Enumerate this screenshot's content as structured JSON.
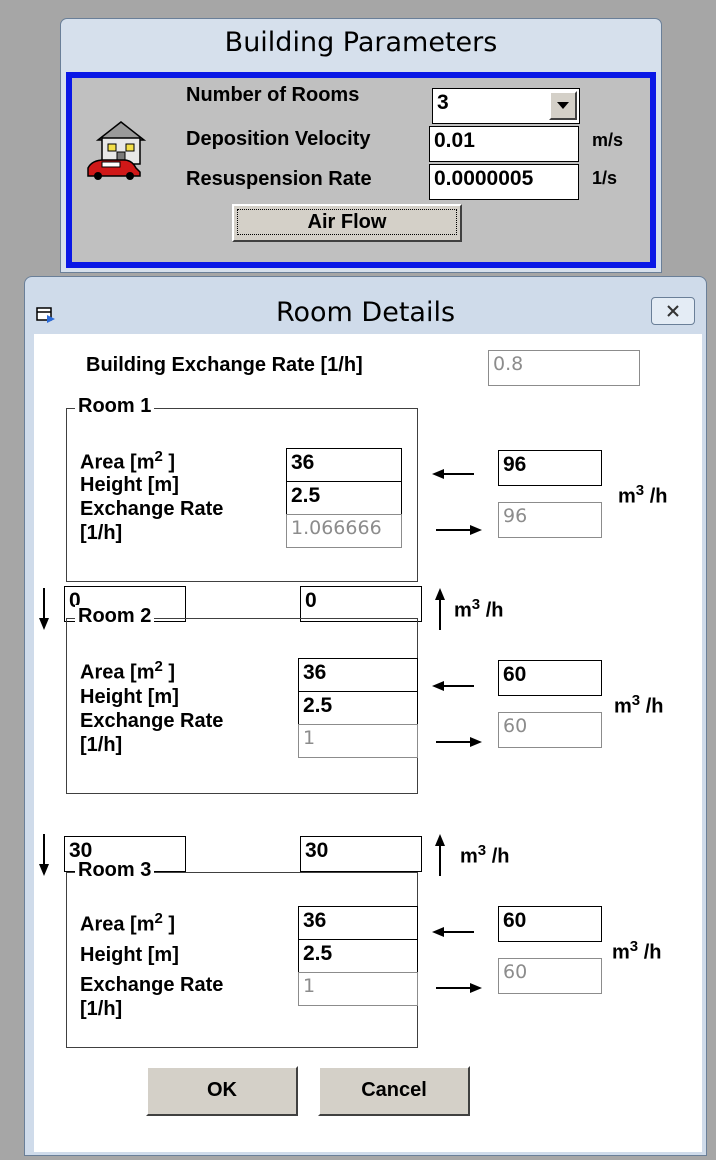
{
  "building_parameters": {
    "title": "Building Parameters",
    "rooms_label": "Number of Rooms",
    "rooms_value": "3",
    "deposition_label": "Deposition Velocity",
    "deposition_value": "0.01",
    "deposition_unit": "m/s",
    "resuspension_label": "Resuspension Rate",
    "resuspension_value": "0.0000005",
    "resuspension_unit": "1/s",
    "airflow_button": "Air Flow"
  },
  "room_details": {
    "title": "Room Details",
    "exchange_rate_label": "Building Exchange Rate [1/h]",
    "exchange_rate_value": "0.8",
    "area_label_pre": "Area [m",
    "area_sup": "2",
    "area_label_post": " ]",
    "height_label": "Height [m]",
    "exch_label_1": "Exchange Rate",
    "exch_label_2": "[1/h]",
    "unit_m": "m",
    "unit_sup": "3",
    "unit_h": " /h",
    "rooms": [
      {
        "name": "Room 1",
        "area": "36",
        "height": "2.5",
        "exchange_rate": "1.066666",
        "flow_in": "96",
        "flow_out": "96"
      },
      {
        "name": "Room 2",
        "area": "36",
        "height": "2.5",
        "exchange_rate": "1",
        "flow_in": "60",
        "flow_out": "60"
      },
      {
        "name": "Room 3",
        "area": "36",
        "height": "2.5",
        "exchange_rate": "1",
        "flow_in": "60",
        "flow_out": "60"
      }
    ],
    "interflows": [
      {
        "down": "0",
        "up": "0"
      },
      {
        "down": "30",
        "up": "30"
      }
    ],
    "ok_button": "OK",
    "cancel_button": "Cancel"
  }
}
